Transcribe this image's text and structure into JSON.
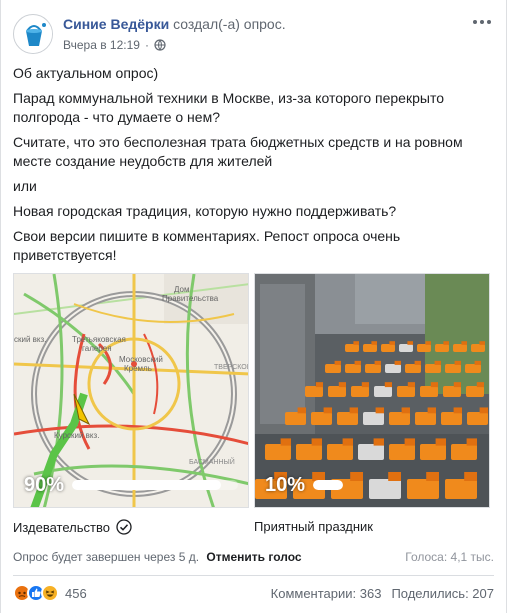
{
  "post": {
    "page_name": "Синие Ведёрки",
    "action": "создал(-а) опрос.",
    "time": "Вчера в 12:19",
    "dot": "·",
    "paragraphs": [
      "Об актуальном опрос)",
      "Парад коммунальной техники в Москве, из-за которого перекрыто полгорода - что думаете о нем?",
      "Считате, что это бесполезная трата бюджетных средств и на ровном месте создание неудобств для жителей",
      "или",
      "Новая городская традиция, которую нужно поддерживать?",
      "Свои версии пишите в комментариях. Репост опроса очень приветствуется!"
    ]
  },
  "map_labels": {
    "dom_pravitelstva_1": "Дом",
    "dom_pravitelstva_2": "Правительства",
    "kiev_vkz": "ский вкз.",
    "tret_1": "Третьяковская",
    "tret_2": "галерея",
    "kreml_1": "Московский",
    "kreml_2": "Кремль",
    "tverskoy": "ТВЕРСКОЙ",
    "kursk_vkz": "Курский вкз.",
    "basmanny": "БАСМАННЫЙ"
  },
  "poll": {
    "options": [
      {
        "label": "Издевательство",
        "percent_text": "90%",
        "percent": 90,
        "voted": true
      },
      {
        "label": "Приятный праздник",
        "percent_text": "10%",
        "percent": 10,
        "voted": false
      }
    ],
    "ends_text": "Опрос будет завершен через 5 д.",
    "cancel_vote": "Отменить голос",
    "votes_text": "Голоса: 4,1 тыс."
  },
  "reactions": {
    "count": "456",
    "comments": "Комментарии: 363",
    "shares": "Поделились: 207"
  },
  "colors": {
    "link": "#385898",
    "angry": "#e9710f",
    "like": "#1877f2",
    "haha": "#f7b125"
  }
}
